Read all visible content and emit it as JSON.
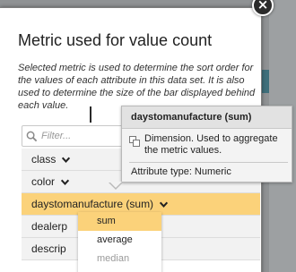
{
  "dialog": {
    "title": "Metric used for value count",
    "description": "Selected metric is used to determine the sort order for the values of each attribute in this data set. It is also used to determine the size of the bar displayed behind each value.",
    "close_symbol": "×"
  },
  "filter": {
    "placeholder": "Filter..."
  },
  "metrics": [
    {
      "label": "class",
      "selected": false
    },
    {
      "label": "color",
      "selected": false
    },
    {
      "label": "daystomanufacture (sum)",
      "selected": true
    },
    {
      "label": "dealerp",
      "selected": false
    },
    {
      "label": "descrip",
      "selected": false
    }
  ],
  "aggregation_options": [
    {
      "label": "sum",
      "state": "active"
    },
    {
      "label": "average",
      "state": "normal"
    },
    {
      "label": "median",
      "state": "faded"
    }
  ],
  "tooltip": {
    "title": "daystomanufacture (sum)",
    "description": "Dimension. Used to aggregate the metric values.",
    "attribute_type": "Attribute type: Numeric"
  },
  "colors": {
    "selected_row": "#fbd27a",
    "row_background": "#f2f2f2",
    "backdrop": "#8f9294",
    "backdrop_band": "#3f6f7b"
  }
}
